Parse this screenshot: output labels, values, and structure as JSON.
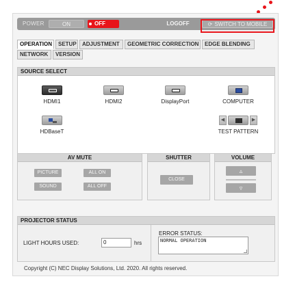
{
  "topbar": {
    "power_label": "POWER",
    "on_label": "ON",
    "off_label": "OFF",
    "logoff_label": "LOGOFF",
    "mobile_label": "SWITCH TO MOBILE",
    "mobile_icon": "refresh-icon",
    "accent_color": "#e8141a"
  },
  "tabs": [
    {
      "label": "OPERATION",
      "active": true
    },
    {
      "label": "SETUP",
      "active": false
    },
    {
      "label": "ADJUSTMENT",
      "active": false
    },
    {
      "label": "GEOMETRIC CORRECTION",
      "active": false
    },
    {
      "label": "EDGE BLENDING",
      "active": false
    },
    {
      "label": "NETWORK",
      "active": false
    },
    {
      "label": "VERSION",
      "active": false
    }
  ],
  "source_select": {
    "title": "SOURCE SELECT",
    "sources": [
      {
        "label": "HDMI1",
        "icon": "hdmi-port-icon",
        "selected": true
      },
      {
        "label": "HDMI2",
        "icon": "hdmi-port-icon",
        "selected": false
      },
      {
        "label": "DisplayPort",
        "icon": "displayport-icon",
        "selected": false
      },
      {
        "label": "COMPUTER",
        "icon": "monitor-icon",
        "selected": false
      },
      {
        "label": "HDBaseT",
        "icon": "network-icon",
        "selected": false
      }
    ],
    "test_pattern": {
      "label": "TEST PATTERN",
      "icon": "grid-pattern-icon"
    }
  },
  "av_mute": {
    "title": "AV MUTE",
    "buttons": {
      "picture": "PICTURE",
      "all_on": "ALL ON",
      "sound": "SOUND",
      "all_off": "ALL OFF"
    }
  },
  "shutter": {
    "title": "SHUTTER",
    "close_label": "CLOSE"
  },
  "volume": {
    "title": "VOLUME",
    "up_glyph": "▵",
    "down_glyph": "▿"
  },
  "projector_status": {
    "title": "PROJECTOR STATUS",
    "light_hours_label": "LIGHT HOURS USED:",
    "light_hours_value": "0",
    "light_hours_unit": "hrs",
    "error_label": "ERROR STATUS:",
    "error_value": "NORMAL OPERATION"
  },
  "footer": {
    "copyright": "Copyright (C) NEC Display Solutions, Ltd. 2020. All rights reserved."
  }
}
